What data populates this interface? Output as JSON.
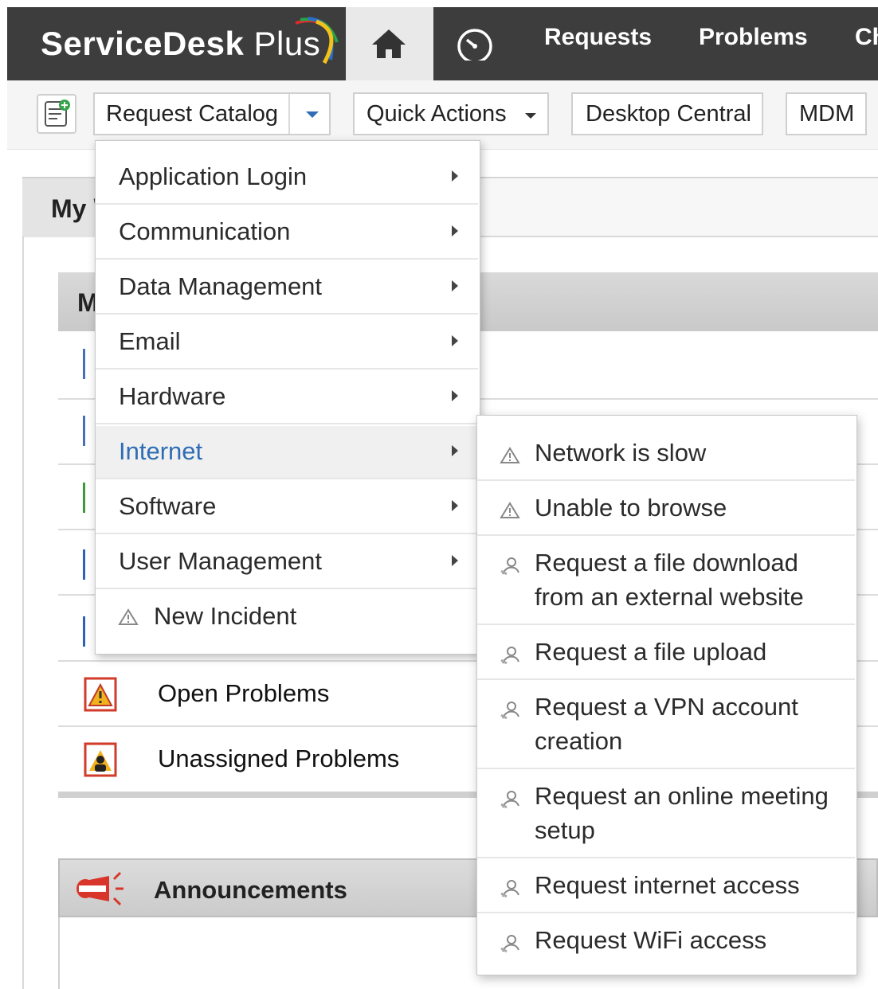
{
  "app": {
    "logo_text_bold": "ServiceDesk",
    "logo_text_thin": " Plus"
  },
  "nav": {
    "items": [
      "Requests",
      "Problems",
      "Ch"
    ]
  },
  "toolbar": {
    "request_catalog": "Request Catalog",
    "quick_actions": "Quick Actions",
    "desktop_central": "Desktop Central",
    "mdm": "MDM"
  },
  "page": {
    "my_view_tab": "My \\",
    "section_header": "M",
    "rows": [
      "Open Problems",
      "Unassigned Problems"
    ],
    "announcements": "Announcements"
  },
  "catalog_menu": {
    "items": [
      "Application Login",
      "Communication",
      "Data Management",
      "Email",
      "Hardware",
      "Internet",
      "Software",
      "User Management",
      "New Incident"
    ],
    "active": "Internet"
  },
  "internet_submenu": {
    "items": [
      "Network is slow",
      "Unable to browse",
      "Request a file download from an external website",
      "Request a file upload",
      "Request a VPN account creation",
      "Request an online meeting setup",
      "Request internet access",
      "Request WiFi access"
    ]
  },
  "colors": {
    "topbar": "#3d3d3d",
    "active_link": "#2f6db5"
  }
}
